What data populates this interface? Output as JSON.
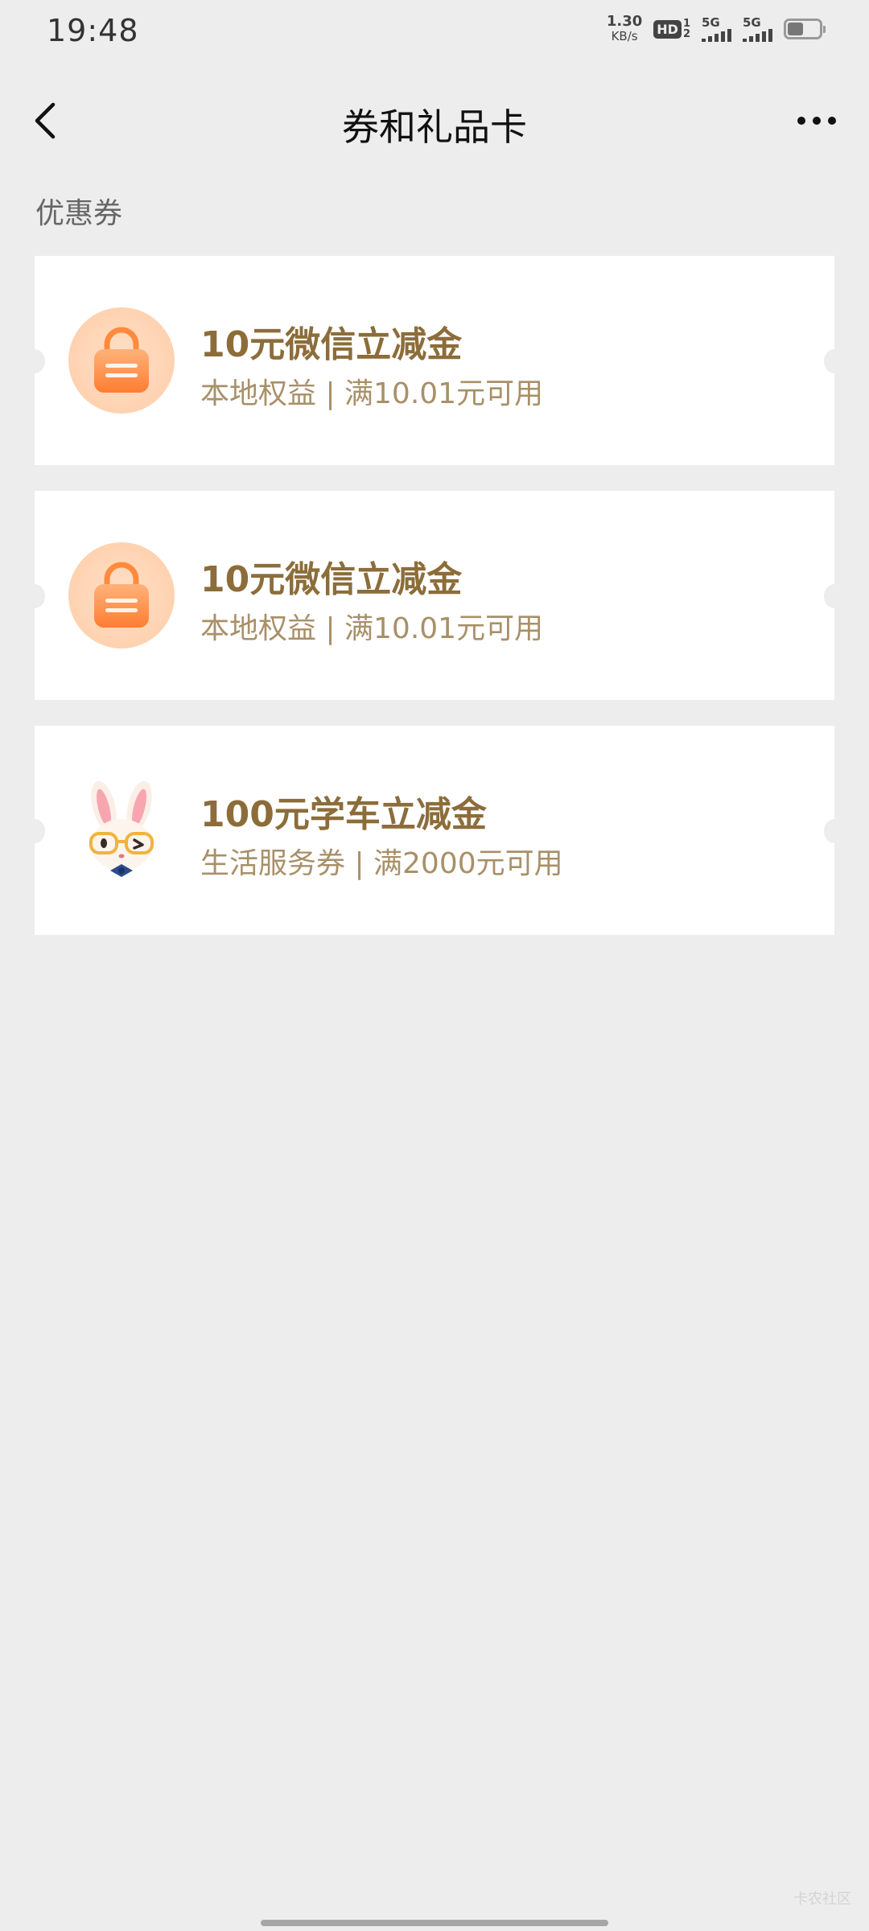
{
  "status_bar": {
    "time": "19:48",
    "net_speed_value": "1.30",
    "net_speed_unit": "KB/s",
    "hd_label": "HD",
    "hd_sub_top": "1",
    "hd_sub_bottom": "2",
    "sim1_label": "5G",
    "sim2_label": "5G",
    "battery_level": 0.45
  },
  "nav": {
    "title": "券和礼品卡",
    "back_icon": "chevron-left-icon",
    "more_icon": "more-horizontal-icon"
  },
  "section": {
    "label": "优惠券"
  },
  "coupons": [
    {
      "title": "10元微信立减金",
      "desc": "本地权益 | 满10.01元可用",
      "icon": "shopping-bag-icon"
    },
    {
      "title": "10元微信立减金",
      "desc": "本地权益 | 满10.01元可用",
      "icon": "shopping-bag-icon"
    },
    {
      "title": "100元学车立减金",
      "desc": "生活服务券 | 满2000元可用",
      "icon": "rabbit-mascot-icon"
    }
  ],
  "watermark": "卡农社区",
  "colors": {
    "background": "#ededed",
    "title_gold": "#8c6d3a",
    "desc_gold": "#a89068",
    "bag_orange": "#ff8a3d"
  }
}
